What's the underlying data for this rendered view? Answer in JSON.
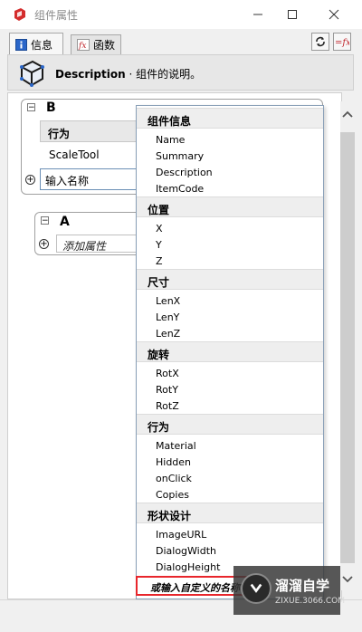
{
  "window": {
    "title": "组件属性",
    "accent": "#d42d2d"
  },
  "tabs": [
    {
      "label": "信息",
      "icon": "info-icon"
    },
    {
      "label": "函数",
      "icon": "fx-icon"
    }
  ],
  "tools": {
    "refresh_icon": "refresh-icon",
    "fx_icon": "fx-icon"
  },
  "description": {
    "name": "Description",
    "text": " · 组件的说明。"
  },
  "componentB": {
    "title": "B",
    "header": "行为",
    "value": "ScaleTool",
    "input_value": "输入名称"
  },
  "componentA": {
    "title": "A",
    "add_placeholder": "添加属性"
  },
  "dropdown": {
    "groups": [
      {
        "label": "组件信息",
        "items": [
          "Name",
          "Summary",
          "Description",
          "ItemCode"
        ]
      },
      {
        "label": "位置",
        "items": [
          "X",
          "Y",
          "Z"
        ]
      },
      {
        "label": "尺寸",
        "items": [
          "LenX",
          "LenY",
          "LenZ"
        ]
      },
      {
        "label": "旋转",
        "items": [
          "RotX",
          "RotY",
          "RotZ"
        ]
      },
      {
        "label": "行为",
        "items": [
          "Material",
          "Hidden",
          "onClick",
          "Copies"
        ]
      },
      {
        "label": "形状设计",
        "items": [
          "ImageURL",
          "DialogWidth",
          "DialogHeight"
        ]
      }
    ],
    "custom_entry": "或输入自定义的名称"
  },
  "watermark": {
    "main": "溜溜自学",
    "sub": "ZIXUE.3066.COM"
  }
}
